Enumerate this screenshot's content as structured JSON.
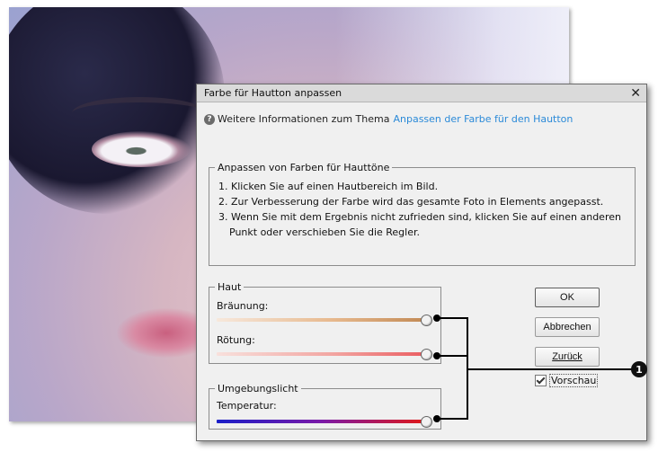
{
  "dialog": {
    "title": "Farbe für Hautton anpassen",
    "close_glyph": "✕",
    "info_text": "Weitere Informationen zum Thema",
    "info_link": "Anpassen der Farbe für den Hautton",
    "instructions_legend": "Anpassen von Farben für Hauttöne",
    "instructions": [
      "1. Klicken Sie auf einen Hautbereich im Bild.",
      "2. Zur Verbesserung der Farbe wird das gesamte Foto in Elements angepasst.",
      "3. Wenn Sie mit dem Ergebnis nicht zufrieden sind, klicken Sie auf einen anderen Punkt oder verschieben Sie die Regler."
    ],
    "skin_legend": "Haut",
    "tan_label": "Bräunung:",
    "blush_label": "Rötung:",
    "ambient_legend": "Umgebungslicht",
    "temperature_label": "Temperatur:",
    "tan_value": 1.0,
    "blush_value": 1.0,
    "temperature_value": 1.0,
    "ok_label": "OK",
    "cancel_label": "Abbrechen",
    "reset_label": "Zurück",
    "preview_label": "Vorschau",
    "preview_checked": true
  },
  "callout": {
    "number": "1"
  },
  "icons": {
    "help": "question-circle-icon",
    "close": "close-icon",
    "checkbox": "checkmark-icon"
  }
}
